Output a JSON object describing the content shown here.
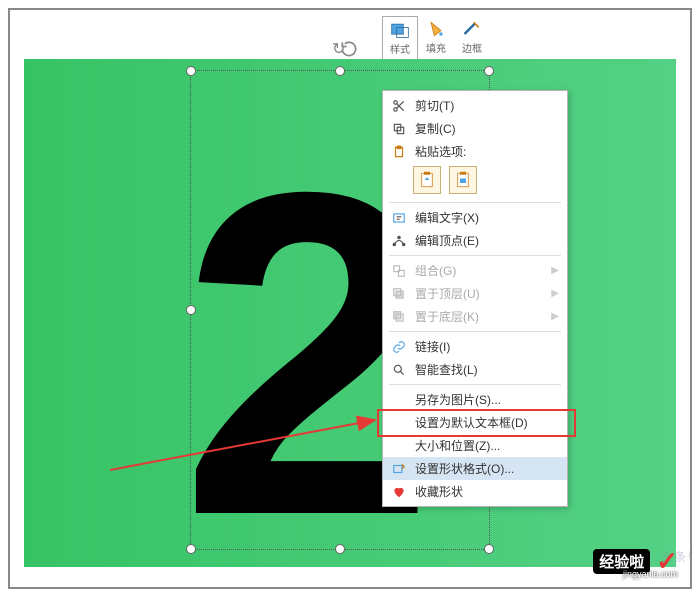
{
  "miniToolbar": {
    "style": "样式",
    "fill": "填充",
    "border": "边框"
  },
  "shapeText": "2",
  "menu": {
    "cut": "剪切(T)",
    "copy": "复制(C)",
    "pasteOptions": "粘贴选项:",
    "editText": "编辑文字(X)",
    "editPoints": "编辑顶点(E)",
    "group": "组合(G)",
    "bringFront": "置于顶层(U)",
    "sendBack": "置于底层(K)",
    "link": "链接(I)",
    "smartFind": "智能查找(L)",
    "saveAsPic": "另存为图片(S)...",
    "setDefaultTextbox": "设置为默认文本框(D)",
    "sizePosition": "大小和位置(Z)...",
    "formatShape": "设置形状格式(O)...",
    "favoriteShape": "收藏形状"
  },
  "watermark": {
    "label": "经验啦",
    "domain": "jingyanla.com",
    "sub": "头条号"
  }
}
